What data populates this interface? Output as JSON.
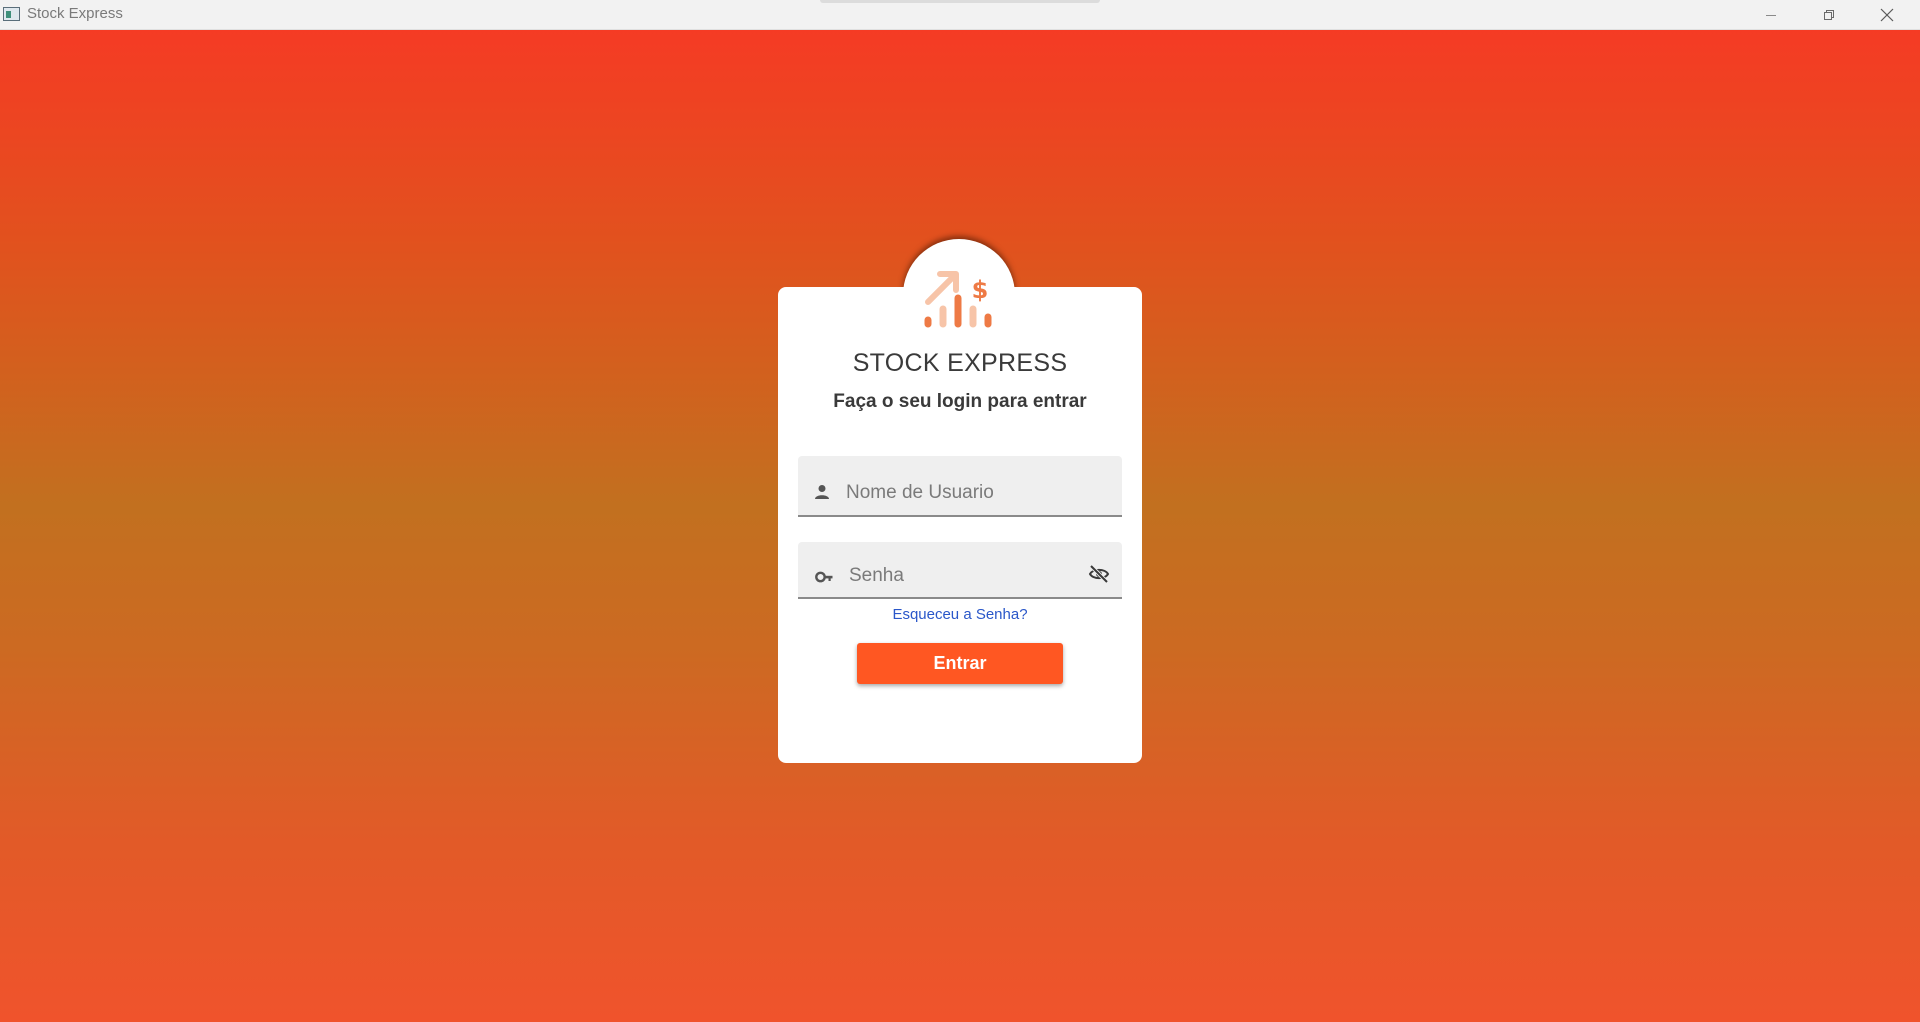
{
  "window": {
    "title": "Stock Express",
    "app_icon": "app-window-icon",
    "controls": [
      "minimize-icon",
      "maximize-icon",
      "close-icon"
    ]
  },
  "login": {
    "logo_icon": "chart-dollar-icon",
    "app_name": "STOCK EXPRESS",
    "subtitle": "Faça o seu login para entrar",
    "username": {
      "icon": "person-icon",
      "placeholder": "Nome de Usuario",
      "value": ""
    },
    "password": {
      "icon": "key-icon",
      "placeholder": "Senha",
      "value": "",
      "toggle_icon": "eye-off-icon"
    },
    "forgot_password": "Esqueceu a Senha?",
    "submit_label": "Entrar"
  },
  "colors": {
    "accent": "#ff5722",
    "background_top": "#f53b24",
    "background_middle": "#c2701f",
    "background_bottom": "#f0532c",
    "link": "#2a57c9",
    "text": "#3a3a3a"
  }
}
